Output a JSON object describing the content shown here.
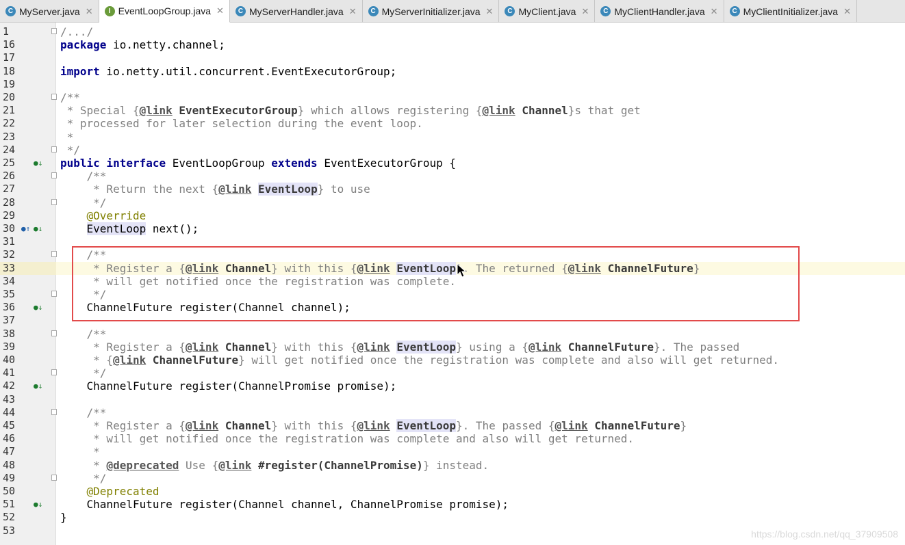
{
  "tabs": [
    {
      "label": "MyServer.java",
      "icon": "class-icon",
      "letter": "C",
      "active": false
    },
    {
      "label": "EventLoopGroup.java",
      "icon": "interface-icon",
      "letter": "I",
      "active": true
    },
    {
      "label": "MyServerHandler.java",
      "icon": "class-icon",
      "letter": "C",
      "active": false
    },
    {
      "label": "MyServerInitializer.java",
      "icon": "class-icon",
      "letter": "C",
      "active": false
    },
    {
      "label": "MyClient.java",
      "icon": "class-icon",
      "letter": "C",
      "active": false
    },
    {
      "label": "MyClientHandler.java",
      "icon": "class-icon",
      "letter": "C",
      "active": false
    },
    {
      "label": "MyClientInitializer.java",
      "icon": "class-icon",
      "letter": "C",
      "active": false
    }
  ],
  "editor": {
    "caret_line": "33",
    "lines": [
      {
        "n": "1",
        "fold": true,
        "segs": [
          [
            "cm",
            "/.../"
          ]
        ]
      },
      {
        "n": "16",
        "segs": [
          [
            "kw",
            "package"
          ],
          [
            "plain",
            " io.netty.channel;"
          ]
        ]
      },
      {
        "n": "17",
        "segs": []
      },
      {
        "n": "18",
        "segs": [
          [
            "kw",
            "import"
          ],
          [
            "plain",
            " io.netty.util.concurrent.EventExecutorGroup;"
          ]
        ]
      },
      {
        "n": "19",
        "segs": []
      },
      {
        "n": "20",
        "fold": true,
        "segs": [
          [
            "cm",
            "/**"
          ]
        ]
      },
      {
        "n": "21",
        "segs": [
          [
            "cm",
            " * Special {"
          ],
          [
            "tag",
            "@link"
          ],
          [
            "ref",
            " EventExecutorGroup"
          ],
          [
            "cm",
            "} which allows registering {"
          ],
          [
            "tag",
            "@link"
          ],
          [
            "ref",
            " Channel"
          ],
          [
            "cm",
            "}s that get"
          ]
        ]
      },
      {
        "n": "22",
        "segs": [
          [
            "cm",
            " * processed for later selection during the event loop."
          ]
        ]
      },
      {
        "n": "23",
        "segs": [
          [
            "cm",
            " *"
          ]
        ]
      },
      {
        "n": "24",
        "fold": true,
        "segs": [
          [
            "cm",
            " */"
          ]
        ]
      },
      {
        "n": "25",
        "icon": "implemented",
        "segs": [
          [
            "kw",
            "public interface"
          ],
          [
            "plain",
            " EventLoopGroup "
          ],
          [
            "kw",
            "extends"
          ],
          [
            "plain",
            " EventExecutorGroup {"
          ]
        ]
      },
      {
        "n": "26",
        "fold": true,
        "segs": [
          [
            "cm",
            "    /**"
          ]
        ]
      },
      {
        "n": "27",
        "segs": [
          [
            "cm",
            "     * Return the next {"
          ],
          [
            "tag",
            "@link"
          ],
          [
            "cm",
            " "
          ],
          [
            "refhl",
            "EventLoop"
          ],
          [
            "cm",
            "} to use"
          ]
        ]
      },
      {
        "n": "28",
        "fold": true,
        "segs": [
          [
            "cm",
            "     */"
          ]
        ]
      },
      {
        "n": "29",
        "segs": [
          [
            "ann",
            "    @Override"
          ]
        ]
      },
      {
        "n": "30",
        "icon": "override-implemented",
        "segs": [
          [
            "plain",
            "    "
          ],
          [
            "hlplain",
            "EventLoop"
          ],
          [
            "plain",
            " next();"
          ]
        ]
      },
      {
        "n": "31",
        "segs": []
      },
      {
        "n": "32",
        "fold": true,
        "segs": [
          [
            "cm",
            "    /**"
          ]
        ]
      },
      {
        "n": "33",
        "segs": [
          [
            "cm",
            "     * Register a {"
          ],
          [
            "tag",
            "@link"
          ],
          [
            "ref",
            " Channel"
          ],
          [
            "cm",
            "} with this {"
          ],
          [
            "tag",
            "@link"
          ],
          [
            "cm",
            " "
          ],
          [
            "refhl",
            "EventLoop"
          ],
          [
            "cm",
            "}. The returned {"
          ],
          [
            "tag",
            "@link"
          ],
          [
            "ref",
            " ChannelFuture"
          ],
          [
            "cm",
            "}"
          ]
        ]
      },
      {
        "n": "34",
        "segs": [
          [
            "cm",
            "     * will get notified once the registration was complete."
          ]
        ]
      },
      {
        "n": "35",
        "fold": true,
        "segs": [
          [
            "cm",
            "     */"
          ]
        ]
      },
      {
        "n": "36",
        "icon": "implemented",
        "segs": [
          [
            "plain",
            "    ChannelFuture register(Channel channel);"
          ]
        ]
      },
      {
        "n": "37",
        "segs": []
      },
      {
        "n": "38",
        "fold": true,
        "segs": [
          [
            "cm",
            "    /**"
          ]
        ]
      },
      {
        "n": "39",
        "segs": [
          [
            "cm",
            "     * Register a {"
          ],
          [
            "tag",
            "@link"
          ],
          [
            "ref",
            " Channel"
          ],
          [
            "cm",
            "} with this {"
          ],
          [
            "tag",
            "@link"
          ],
          [
            "cm",
            " "
          ],
          [
            "refhl",
            "EventLoop"
          ],
          [
            "cm",
            "} using a {"
          ],
          [
            "tag",
            "@link"
          ],
          [
            "ref",
            " ChannelFuture"
          ],
          [
            "cm",
            "}. The passed"
          ]
        ]
      },
      {
        "n": "40",
        "segs": [
          [
            "cm",
            "     * {"
          ],
          [
            "tag",
            "@link"
          ],
          [
            "ref",
            " ChannelFuture"
          ],
          [
            "cm",
            "} will get notified once the registration was complete and also will get returned."
          ]
        ]
      },
      {
        "n": "41",
        "fold": true,
        "segs": [
          [
            "cm",
            "     */"
          ]
        ]
      },
      {
        "n": "42",
        "icon": "implemented",
        "segs": [
          [
            "plain",
            "    ChannelFuture register(ChannelPromise promise);"
          ]
        ]
      },
      {
        "n": "43",
        "segs": []
      },
      {
        "n": "44",
        "fold": true,
        "segs": [
          [
            "cm",
            "    /**"
          ]
        ]
      },
      {
        "n": "45",
        "segs": [
          [
            "cm",
            "     * Register a {"
          ],
          [
            "tag",
            "@link"
          ],
          [
            "ref",
            " Channel"
          ],
          [
            "cm",
            "} with this {"
          ],
          [
            "tag",
            "@link"
          ],
          [
            "cm",
            " "
          ],
          [
            "refhl",
            "EventLoop"
          ],
          [
            "cm",
            "}. The passed {"
          ],
          [
            "tag",
            "@link"
          ],
          [
            "ref",
            " ChannelFuture"
          ],
          [
            "cm",
            "}"
          ]
        ]
      },
      {
        "n": "46",
        "segs": [
          [
            "cm",
            "     * will get notified once the registration was complete and also will get returned."
          ]
        ]
      },
      {
        "n": "47",
        "segs": [
          [
            "cm",
            "     *"
          ]
        ]
      },
      {
        "n": "48",
        "segs": [
          [
            "cm",
            "     * "
          ],
          [
            "tag",
            "@deprecated"
          ],
          [
            "cm",
            " Use {"
          ],
          [
            "tag",
            "@link"
          ],
          [
            "ref",
            " #register(ChannelPromise)"
          ],
          [
            "cm",
            "} instead."
          ]
        ]
      },
      {
        "n": "49",
        "fold": true,
        "segs": [
          [
            "cm",
            "     */"
          ]
        ]
      },
      {
        "n": "50",
        "segs": [
          [
            "ann",
            "    @Deprecated"
          ]
        ]
      },
      {
        "n": "51",
        "icon": "implemented",
        "segs": [
          [
            "plain",
            "    ChannelFuture register(Channel channel, ChannelPromise promise);"
          ]
        ]
      },
      {
        "n": "52",
        "segs": [
          [
            "plain",
            "}"
          ]
        ]
      },
      {
        "n": "53",
        "segs": []
      }
    ]
  },
  "watermark": "https://blog.csdn.net/qq_37909508",
  "colors": {
    "highlight_box": "#e24a4a",
    "keyword": "#00008b",
    "comment": "#7f7f7f",
    "annotation": "#808000"
  }
}
